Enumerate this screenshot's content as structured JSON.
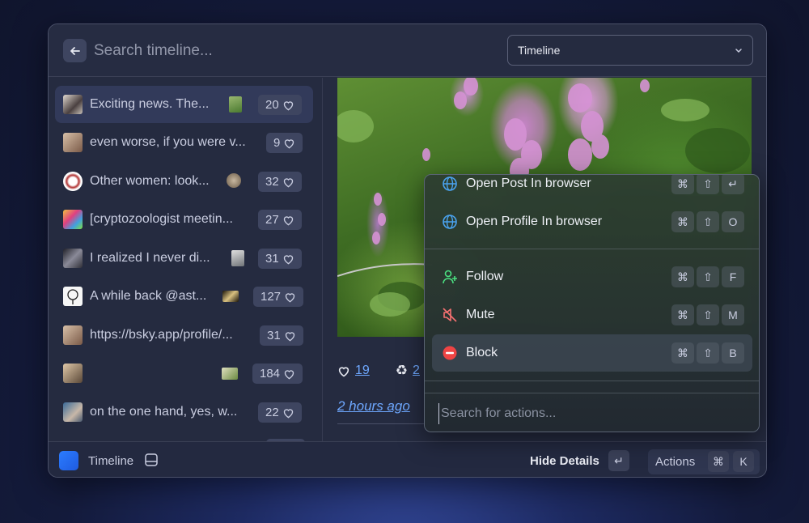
{
  "header": {
    "search_placeholder": "Search timeline...",
    "dropdown_value": "Timeline"
  },
  "list": {
    "items": [
      {
        "text": "Exciting news. The...",
        "count": "20",
        "has_thumb": true,
        "avatar_color": "#c8c0b8",
        "thumb_color": "#7aa05a"
      },
      {
        "text": "even worse, if you were v...",
        "count": "9",
        "has_thumb": false,
        "avatar_color": "#b89a86"
      },
      {
        "text": "Other women: look...",
        "count": "32",
        "has_thumb": true,
        "avatar_color": "#f2e8e8",
        "thumb_color": "#a09080"
      },
      {
        "text": "[cryptozoologist meetin...",
        "count": "27",
        "has_thumb": false,
        "avatar_color": "#d86aa8"
      },
      {
        "text": "I realized I never di...",
        "count": "31",
        "has_thumb": true,
        "avatar_color": "#5a6070",
        "thumb_color": "#c0c4c8"
      },
      {
        "text": "A while back @ast...",
        "count": "127",
        "has_thumb": true,
        "avatar_color": "#f4f4f4",
        "thumb_color": "#3a3020"
      },
      {
        "text": "https://bsky.app/profile/...",
        "count": "31",
        "has_thumb": false,
        "avatar_color": "#b8927e"
      },
      {
        "text": "",
        "count": "184",
        "has_thumb": true,
        "avatar_color": "#c0a890",
        "thumb_color": "#8aa070"
      },
      {
        "text": "on the one hand, yes, w...",
        "count": "22",
        "has_thumb": false,
        "avatar_color": "#5a7890"
      }
    ]
  },
  "detail": {
    "likes": "19",
    "reposts": "2",
    "time": "2 hours ago"
  },
  "menu": {
    "items": [
      {
        "label": "Open Post In browser",
        "keys": [
          "⌘",
          "⇧",
          "↵"
        ],
        "icon": "globe-icon"
      },
      {
        "label": "Open Profile In browser",
        "keys": [
          "⌘",
          "⇧",
          "O"
        ],
        "icon": "globe-icon"
      },
      {
        "label": "Follow",
        "keys": [
          "⌘",
          "⇧",
          "F"
        ],
        "icon": "user-plus-icon"
      },
      {
        "label": "Mute",
        "keys": [
          "⌘",
          "⇧",
          "M"
        ],
        "icon": "mute-icon"
      },
      {
        "label": "Block",
        "keys": [
          "⌘",
          "⇧",
          "B"
        ],
        "icon": "block-icon"
      }
    ],
    "search_placeholder": "Search for actions..."
  },
  "footer": {
    "title": "Timeline",
    "hide_details": "Hide Details",
    "hide_key": "↵",
    "actions": "Actions",
    "actions_keys": [
      "⌘",
      "K"
    ]
  },
  "colors": {
    "accent": "#6ea8ff",
    "follow": "#4ade80",
    "mute": "#f87171",
    "block": "#ef4444",
    "globe": "#4aa3f0"
  }
}
